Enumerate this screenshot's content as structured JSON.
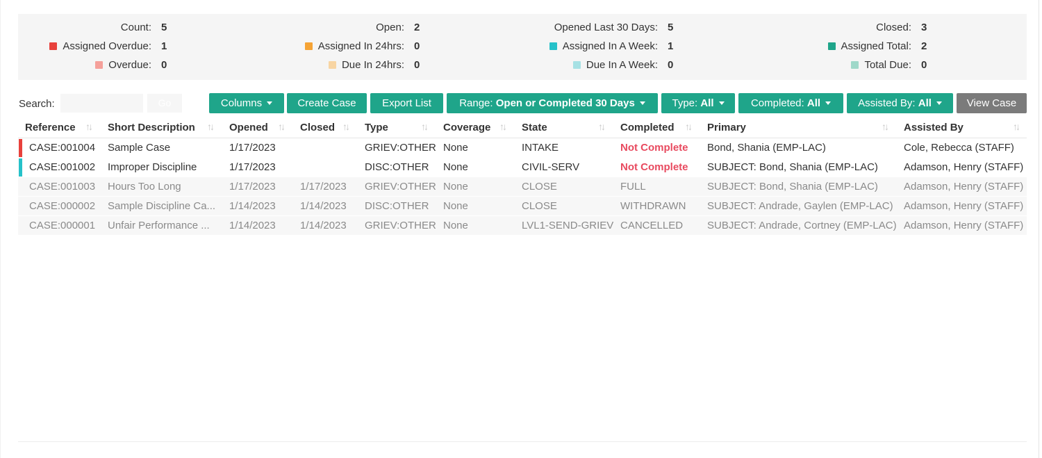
{
  "stats": {
    "row1": [
      {
        "label": "Count:",
        "value": "5"
      },
      {
        "label": "Open:",
        "value": "2"
      },
      {
        "label": "Opened Last 30 Days:",
        "value": "5"
      },
      {
        "label": "Closed:",
        "value": "3"
      }
    ],
    "row2": [
      {
        "label": "Assigned Overdue:",
        "value": "1",
        "color": "#e8413c"
      },
      {
        "label": "Assigned In 24hrs:",
        "value": "0",
        "color": "#f5a335"
      },
      {
        "label": "Assigned In A Week:",
        "value": "1",
        "color": "#26c1c9"
      },
      {
        "label": "Assigned Total:",
        "value": "2",
        "color": "#1fa58a"
      }
    ],
    "row3": [
      {
        "label": "Overdue:",
        "value": "0",
        "color": "#f5a09a"
      },
      {
        "label": "Due In 24hrs:",
        "value": "0",
        "color": "#f8d5a3"
      },
      {
        "label": "Due In A Week:",
        "value": "0",
        "color": "#a6e1e4"
      },
      {
        "label": "Total Due:",
        "value": "0",
        "color": "#9fd8c9"
      }
    ]
  },
  "toolbar": {
    "search_label": "Search:",
    "search_value": "",
    "go_label": "Go",
    "columns_label": "Columns",
    "create_case_label": "Create Case",
    "export_list_label": "Export List",
    "range_prefix": "Range:",
    "range_value": "Open or Completed 30 Days",
    "type_prefix": "Type:",
    "type_value": "All",
    "completed_prefix": "Completed:",
    "completed_value": "All",
    "assisted_prefix": "Assisted By:",
    "assisted_value": "All",
    "view_case_label": "View Case"
  },
  "table": {
    "headers": [
      "Reference",
      "Short Description",
      "Opened",
      "Closed",
      "Type",
      "Coverage",
      "State",
      "Completed",
      "Primary",
      "Assisted By"
    ],
    "rows": [
      {
        "reference": "CASE:001004",
        "description": "Sample Case",
        "opened": "1/17/2023",
        "closed": "",
        "type": "GRIEV:OTHER",
        "coverage": "None",
        "state": "INTAKE",
        "completed": "Not Complete",
        "primary": "Bond, Shania (EMP-LAC)",
        "assisted_by": "Cole, Rebecca (STAFF)",
        "status_color": "#e8413c"
      },
      {
        "reference": "CASE:001002",
        "description": "Improper Discipline",
        "opened": "1/17/2023",
        "closed": "",
        "type": "DISC:OTHER",
        "coverage": "None",
        "state": "CIVIL-SERV",
        "completed": "Not Complete",
        "primary": "SUBJECT: Bond, Shania (EMP-LAC)",
        "assisted_by": "Adamson, Henry (STAFF)",
        "status_color": "#26c1c9"
      },
      {
        "reference": "CASE:001003",
        "description": "Hours Too Long",
        "opened": "1/17/2023",
        "closed": "1/17/2023",
        "type": "GRIEV:OTHER",
        "coverage": "None",
        "state": "CLOSE",
        "completed": "FULL",
        "primary": "SUBJECT: Bond, Shania (EMP-LAC)",
        "assisted_by": "Adamson, Henry (STAFF)"
      },
      {
        "reference": "CASE:000002",
        "description": "Sample Discipline Ca...",
        "opened": "1/14/2023",
        "closed": "1/14/2023",
        "type": "DISC:OTHER",
        "coverage": "None",
        "state": "CLOSE",
        "completed": "WITHDRAWN",
        "primary": "SUBJECT: Andrade, Gaylen (EMP-LAC)",
        "assisted_by": "Adamson, Henry (STAFF)"
      },
      {
        "reference": "CASE:000001",
        "description": "Unfair Performance ...",
        "opened": "1/14/2023",
        "closed": "1/14/2023",
        "type": "GRIEV:OTHER",
        "coverage": "None",
        "state": "LVL1-SEND-GRIEV",
        "completed": "CANCELLED",
        "primary": "SUBJECT: Andrade, Cortney (EMP-LAC)",
        "assisted_by": "Adamson, Henry (STAFF)"
      }
    ]
  },
  "icons": {
    "sort": "sort-icon",
    "caret": "caret-down-icon"
  }
}
